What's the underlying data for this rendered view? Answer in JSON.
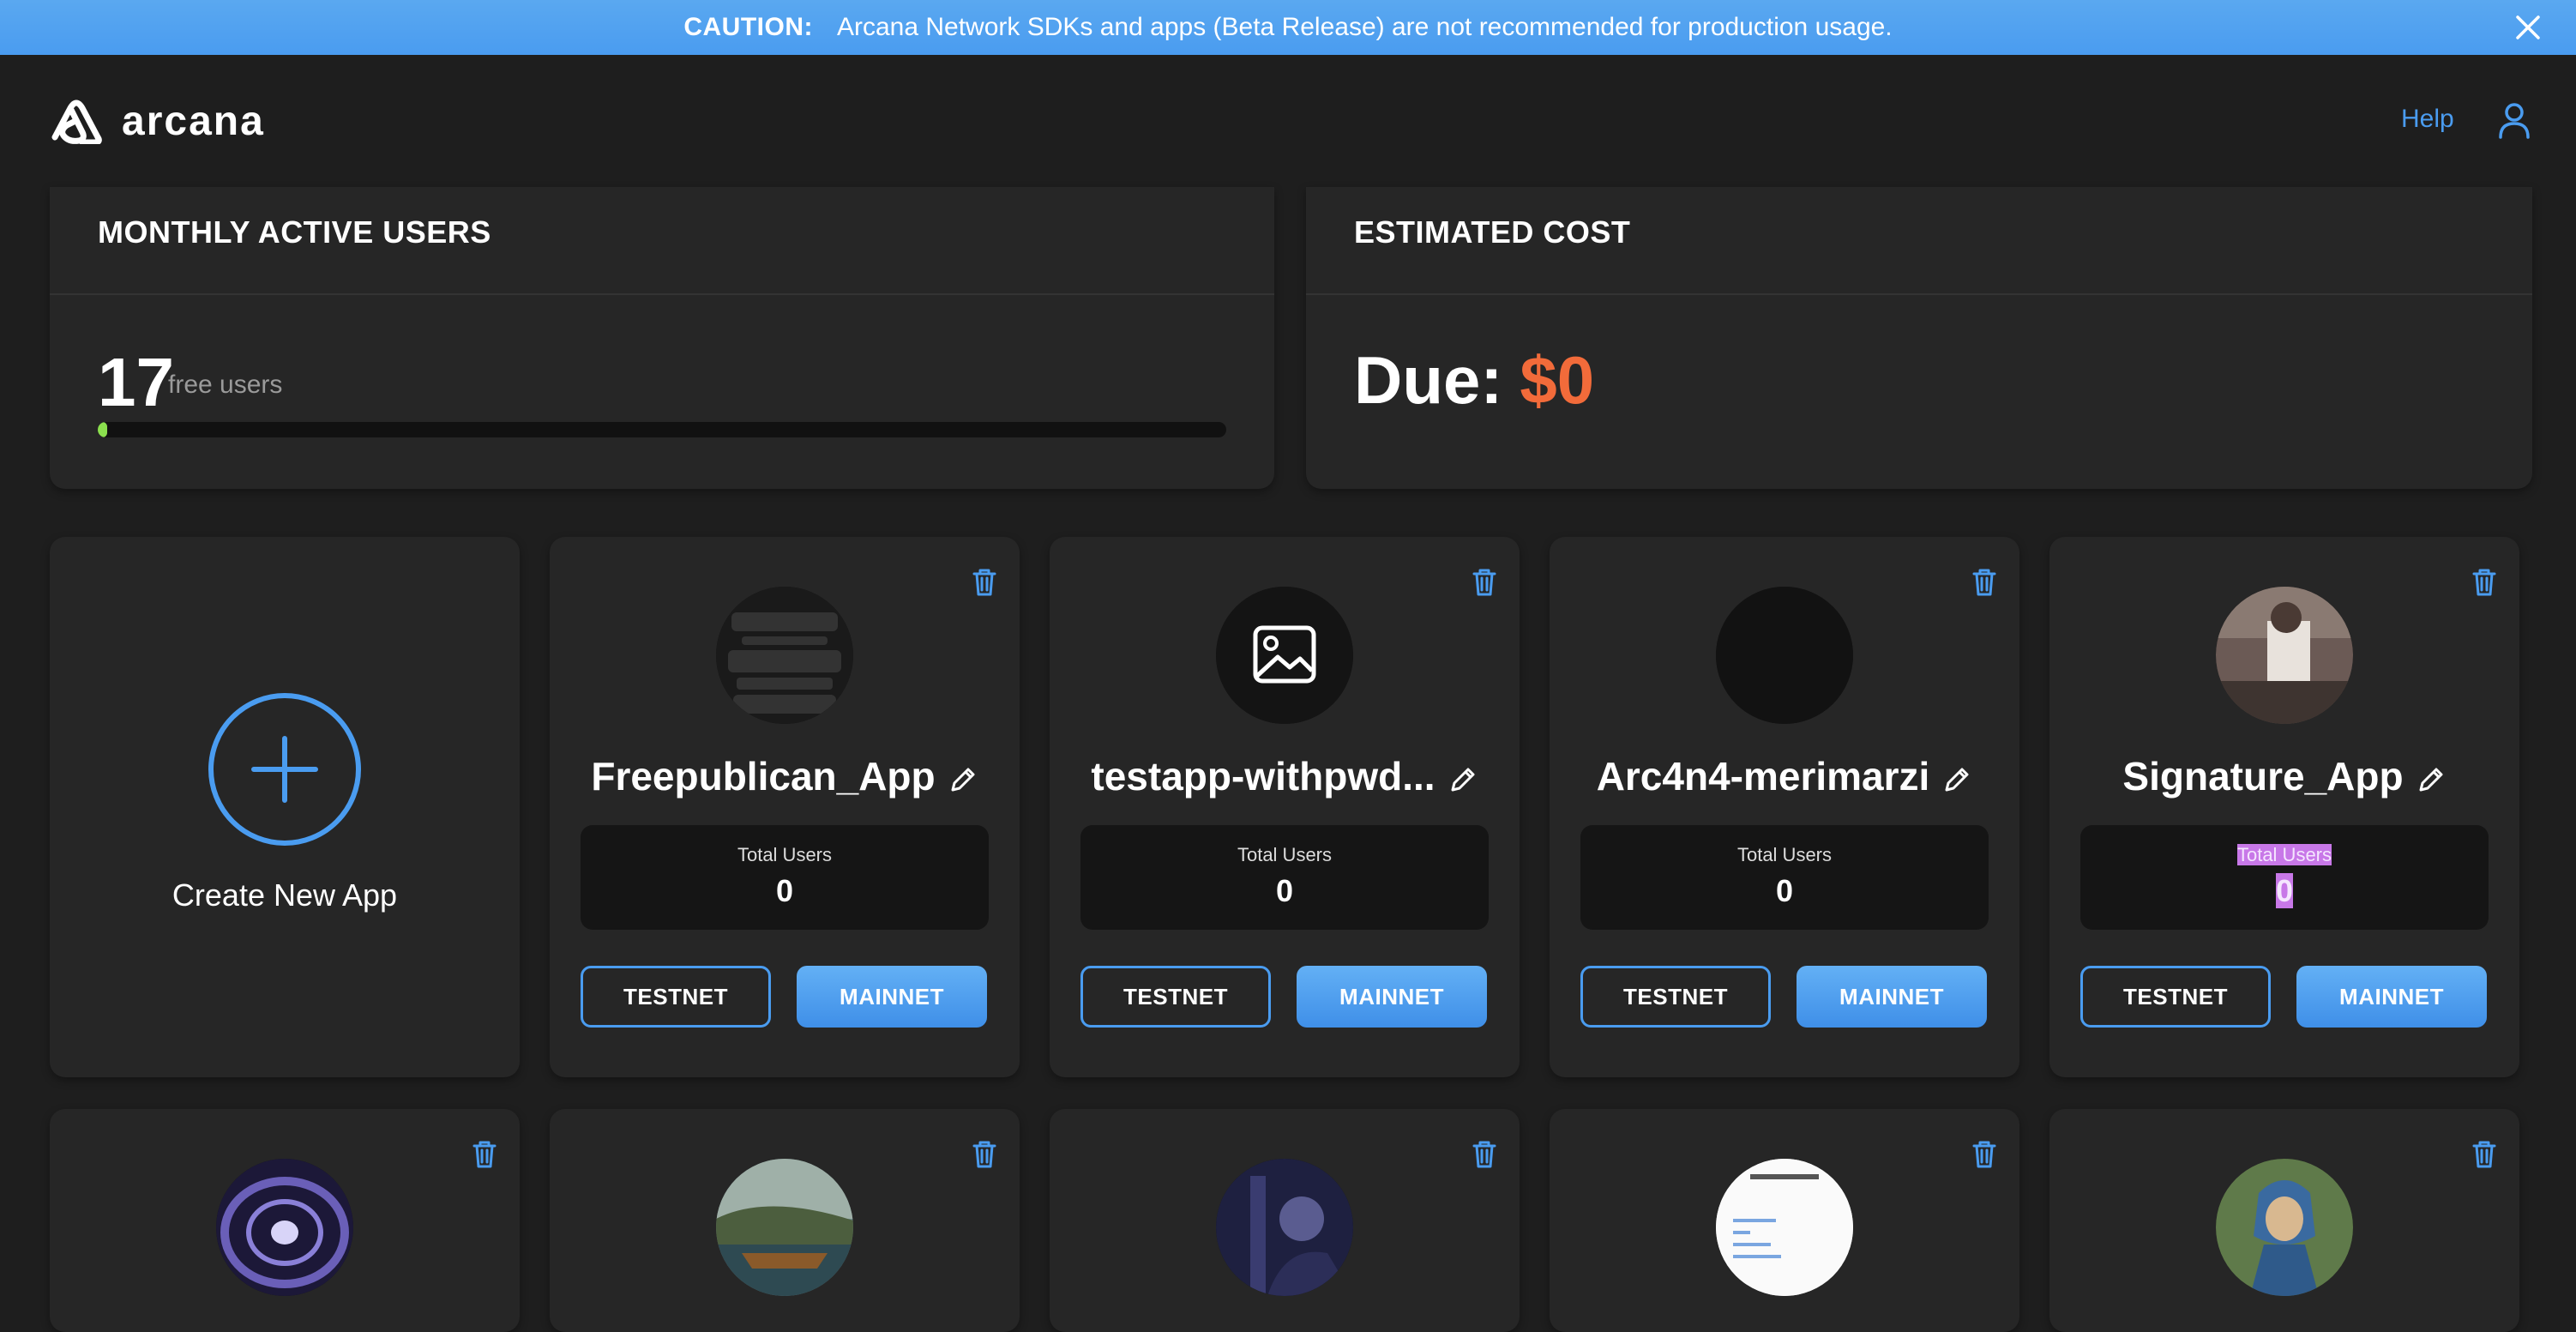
{
  "banner": {
    "caution_label": "CAUTION:",
    "message": "Arcana Network SDKs and apps (Beta Release) are not recommended for production usage."
  },
  "header": {
    "logo_text": "arcana",
    "help_label": "Help"
  },
  "monthly_active_users": {
    "title": "MONTHLY ACTIVE USERS",
    "count": "17",
    "count_label": "free users",
    "progress_fraction": 0.008
  },
  "estimated_cost": {
    "title": "ESTIMATED COST",
    "due_label": "Due:",
    "due_value": "$0"
  },
  "create_app": {
    "label": "Create New App"
  },
  "apps": [
    {
      "name": "Freepublican_App",
      "total_users_label": "Total Users",
      "total_users": "0",
      "testnet_label": "TESTNET",
      "mainnet_label": "MAINNET"
    },
    {
      "name": "testapp-withpwd...",
      "total_users_label": "Total Users",
      "total_users": "0",
      "testnet_label": "TESTNET",
      "mainnet_label": "MAINNET"
    },
    {
      "name": "Arc4n4-merimarzi",
      "total_users_label": "Total Users",
      "total_users": "0",
      "testnet_label": "TESTNET",
      "mainnet_label": "MAINNET"
    },
    {
      "name": "Signature_App",
      "total_users_label": "Total Users",
      "total_users": "0",
      "testnet_label": "TESTNET",
      "mainnet_label": "MAINNET"
    }
  ],
  "colors": {
    "accent": "#4a9cf0",
    "due": "#f26b3a",
    "progress": "#8be04e",
    "background": "#1e1e1e",
    "card": "#262626"
  }
}
